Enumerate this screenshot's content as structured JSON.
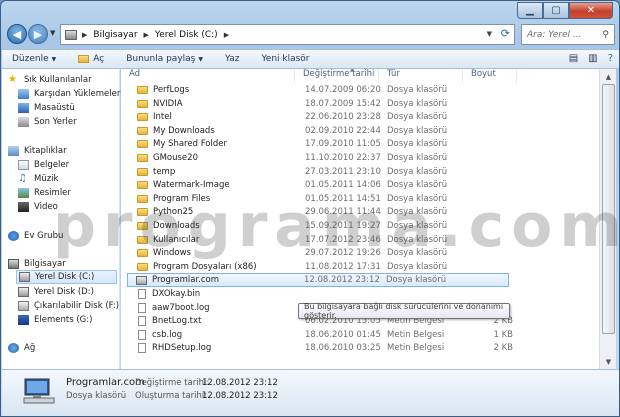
{
  "window": {
    "min_icon": "minimize-icon",
    "max_icon": "maximize-icon",
    "close_label": "✕"
  },
  "address": {
    "crumbs": [
      "Bilgisayar",
      "Yerel Disk (C:)"
    ],
    "separator": "▶",
    "search_placeholder": "Ara: Yerel ..."
  },
  "toolbar": {
    "organize": "Düzenle",
    "open": "Aç",
    "share": "Bununla paylaş",
    "print": "Yaz",
    "new_folder": "Yeni klasör"
  },
  "sidebar": {
    "favorites": "Sık Kullanılanlar",
    "downloads": "Karşıdan Yüklemeler",
    "desktop": "Masaüstü",
    "recent": "Son Yerler",
    "libraries": "Kitaplıklar",
    "documents": "Belgeler",
    "music": "Müzik",
    "pictures": "Resimler",
    "video": "Video",
    "homegroup": "Ev Grubu",
    "computer": "Bilgisayar",
    "drive_c": "Yerel Disk (C:)",
    "drive_d": "Yerel Disk (D:)",
    "drive_f": "Çıkarılabilir Disk (F:)",
    "drive_g": "Elements (G:)",
    "network": "Ağ"
  },
  "columns": {
    "name": "Ad",
    "date": "Değiştirme tarihi",
    "type": "Tür",
    "size": "Boyut"
  },
  "files": [
    {
      "name": "PerfLogs",
      "date": "14.07.2009 06:20",
      "type": "Dosya klasörü",
      "size": "",
      "kind": "folder"
    },
    {
      "name": "NVIDIA",
      "date": "18.07.2009 15:42",
      "type": "Dosya klasörü",
      "size": "",
      "kind": "folder"
    },
    {
      "name": "Intel",
      "date": "22.06.2010 23:28",
      "type": "Dosya klasörü",
      "size": "",
      "kind": "folder"
    },
    {
      "name": "My Downloads",
      "date": "02.09.2010 22:44",
      "type": "Dosya klasörü",
      "size": "",
      "kind": "folder"
    },
    {
      "name": "My Shared Folder",
      "date": "17.09.2010 11:05",
      "type": "Dosya klasörü",
      "size": "",
      "kind": "folder"
    },
    {
      "name": "GMouse20",
      "date": "11.10.2010 22:37",
      "type": "Dosya klasörü",
      "size": "",
      "kind": "folder"
    },
    {
      "name": "temp",
      "date": "27.03.2011 23:10",
      "type": "Dosya klasörü",
      "size": "",
      "kind": "folder"
    },
    {
      "name": "Watermark-Image",
      "date": "01.05.2011 14:06",
      "type": "Dosya klasörü",
      "size": "",
      "kind": "folder"
    },
    {
      "name": "Program Files",
      "date": "01.05.2011 14:51",
      "type": "Dosya klasörü",
      "size": "",
      "kind": "folder"
    },
    {
      "name": "Python25",
      "date": "29.06.2011 11:44",
      "type": "Dosya klasörü",
      "size": "",
      "kind": "folder"
    },
    {
      "name": "Downloads",
      "date": "15.09.2011 19:27",
      "type": "Dosya klasörü",
      "size": "",
      "kind": "folder"
    },
    {
      "name": "Kullanıcılar",
      "date": "17.07.2012 23:46",
      "type": "Dosya klasörü",
      "size": "",
      "kind": "folder"
    },
    {
      "name": "Windows",
      "date": "29.07.2012 19:26",
      "type": "Dosya klasörü",
      "size": "",
      "kind": "folder"
    },
    {
      "name": "Program Dosyaları (x86)",
      "date": "11.08.2012 17:31",
      "type": "Dosya klasörü",
      "size": "",
      "kind": "folder"
    },
    {
      "name": "Programlar.com",
      "date": "12.08.2012 23:12",
      "type": "Dosya klasörü",
      "size": "",
      "kind": "drive"
    },
    {
      "name": "DXOkay.bin",
      "date": "",
      "type": "",
      "size": "",
      "kind": "file"
    },
    {
      "name": "aaw7boot.log",
      "date": "",
      "type": "Metin Belgesi",
      "size": "",
      "kind": "file"
    },
    {
      "name": "BnetLog.txt",
      "date": "06.02.2010 15:05",
      "type": "Metin Belgesi",
      "size": "2 KB",
      "kind": "file"
    },
    {
      "name": "csb.log",
      "date": "18.06.2010 01:45",
      "type": "Metin Belgesi",
      "size": "1 KB",
      "kind": "file"
    },
    {
      "name": "RHDSetup.log",
      "date": "18.06.2010 03:25",
      "type": "Metin Belgesi",
      "size": "2 KB",
      "kind": "file"
    }
  ],
  "tooltip": "Bu bilgisayara bağlı disk sürücülerini ve donanımı gösterir.",
  "details": {
    "name": "Programlar.com",
    "kind": "Dosya klasörü",
    "modified_label": "Değiştirme tarihi:",
    "modified_value": "12.08.2012 23:12",
    "created_label": "Oluşturma tarihi:",
    "created_value": "12.08.2012 23:12"
  },
  "watermark": "programa.com"
}
